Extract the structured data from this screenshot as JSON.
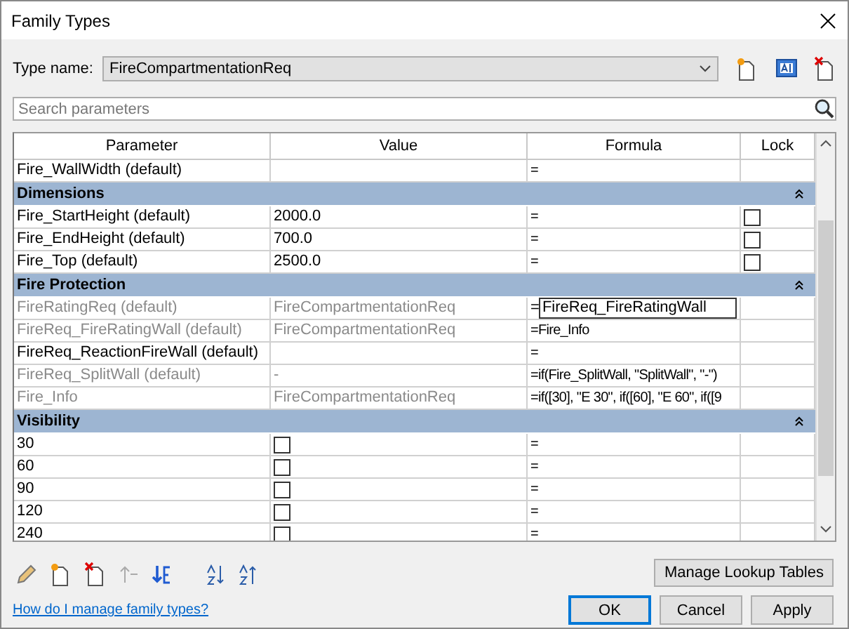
{
  "window": {
    "title": "Family Types"
  },
  "type_name": {
    "label": "Type name:",
    "value": "FireCompartmentationReq"
  },
  "search": {
    "placeholder": "Search parameters"
  },
  "table": {
    "columns": [
      "Parameter",
      "Value",
      "Formula",
      "Lock"
    ],
    "rows": [
      {
        "kind": "param",
        "name": "Fire_WallWidth (default)",
        "value": "",
        "formula": "=",
        "disabled": false
      },
      {
        "kind": "group",
        "name": "Dimensions",
        "expanded": true
      },
      {
        "kind": "param",
        "name": "Fire_StartHeight (default)",
        "value": "2000.0",
        "formula": "=",
        "disabled": false,
        "locked": false
      },
      {
        "kind": "param",
        "name": "Fire_EndHeight (default)",
        "value": "700.0",
        "formula": "=",
        "disabled": false,
        "locked": false
      },
      {
        "kind": "param",
        "name": "Fire_Top (default)",
        "value": "2500.0",
        "formula": "=",
        "disabled": false,
        "locked": false
      },
      {
        "kind": "group",
        "name": "Fire Protection",
        "expanded": true
      },
      {
        "kind": "param",
        "name": "FireRatingReq (default)",
        "value": "FireCompartmentationReq",
        "formula": "=",
        "formula_edit": "FireReq_FireRatingWall",
        "disabled": true
      },
      {
        "kind": "param",
        "name": "FireReq_FireRatingWall (default)",
        "value": "FireCompartmentationReq",
        "formula": "=Fire_Info",
        "disabled": true
      },
      {
        "kind": "param",
        "name": "FireReq_ReactionFireWall (default)",
        "value": "",
        "formula": "=",
        "disabled": false
      },
      {
        "kind": "param",
        "name": "FireReq_SplitWall (default)",
        "value": "-",
        "formula": "=if(Fire_SplitWall, \"SplitWall\", \"-\")",
        "disabled": true
      },
      {
        "kind": "param",
        "name": "Fire_Info",
        "value": "FireCompartmentationReq",
        "formula": "=if([30], \"E 30\", if([60], \"E 60\", if([9",
        "disabled": true
      },
      {
        "kind": "group",
        "name": "Visibility",
        "expanded": true
      },
      {
        "kind": "check",
        "name": "30",
        "checked": false,
        "formula": "=",
        "disabled": false
      },
      {
        "kind": "check",
        "name": "60",
        "checked": false,
        "formula": "=",
        "disabled": false
      },
      {
        "kind": "check",
        "name": "90",
        "checked": false,
        "formula": "=",
        "disabled": false
      },
      {
        "kind": "check",
        "name": "120",
        "checked": false,
        "formula": "=",
        "disabled": false
      },
      {
        "kind": "check",
        "name": "240",
        "checked": false,
        "formula": "=",
        "disabled": false
      }
    ]
  },
  "lookup_button": "Manage Lookup Tables",
  "help_link": "How do I manage family types?",
  "buttons": [
    {
      "label": "OK",
      "selected": true
    },
    {
      "label": "Cancel",
      "selected": false
    },
    {
      "label": "Apply",
      "selected": false
    }
  ]
}
